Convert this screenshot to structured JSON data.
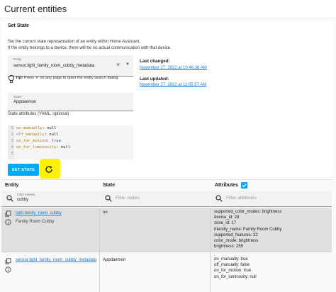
{
  "page": {
    "title": "Current entities"
  },
  "set_state": {
    "heading": "Set State",
    "description_line1": "Set the current state representation of an entity within Home Assistant.",
    "description_line2": "If the entity belongs to a device, there will be no actual communication with that device.",
    "entity_label": "Entity",
    "entity_value": "sensor.light_family_room_cubby_metadata",
    "tip_bold": "Tip!",
    "tip_text": " Press 'e' on any page to open the entity search dialog",
    "state_label": "State*",
    "state_value": "Appdaemon",
    "attributes_label": "State attributes (YAML, optional)",
    "yaml_lines": [
      {
        "num": "1",
        "key": "on_manually",
        "value": "null"
      },
      {
        "num": "2",
        "key": "off_manually",
        "value": "null"
      },
      {
        "num": "3",
        "key": "on_for_motion",
        "value": "true"
      },
      {
        "num": "4",
        "key": "on_for_luminosity",
        "value": "null"
      },
      {
        "num": "5",
        "key": "",
        "value": ""
      }
    ],
    "set_state_button": "SET STATE",
    "last_changed_label": "Last changed:",
    "last_changed_value": "November 27, 2022 at 10:46:36 AM",
    "last_updated_label": "Last updated:",
    "last_updated_value": "November 27, 2022 at 11:05:57 AM"
  },
  "table": {
    "headers": {
      "entity": "Entity",
      "state": "State",
      "attributes": "Attributes"
    },
    "entity_filter_label": "Filter entities",
    "entity_filter_value": "cubby",
    "state_filter_placeholder": "Filter states",
    "attributes_filter_placeholder": "Filter attributes",
    "rows": [
      {
        "entity_id": "light.family_room_cubby",
        "friendly_name": "Family Room Cubby",
        "state": "on",
        "attributes": [
          "supported_color_modes: brightness",
          "device_id: 28",
          "zone_id: 17",
          "friendly_name: Family Room Cubby",
          "supported_features: 32",
          "color_mode: brightness",
          "brightness: 255"
        ]
      },
      {
        "entity_id": "sensor.light_family_room_cubby_metadata",
        "state": "Appdaemon",
        "attributes": [
          "on_manually: true",
          "off_manually: false",
          "on_for_motion: true",
          "on_for_luminosity: null"
        ]
      }
    ]
  },
  "colors": {
    "accent": "#03a9f4",
    "link": "#1976d2",
    "highlight": "#fff200"
  }
}
